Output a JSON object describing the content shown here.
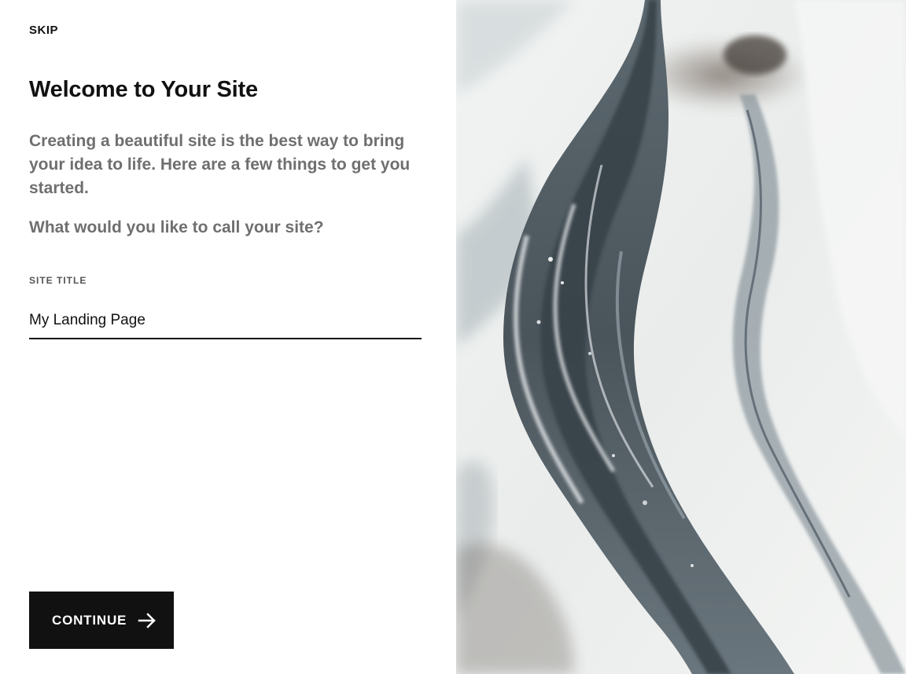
{
  "header": {
    "skip_label": "SKIP"
  },
  "main": {
    "title": "Welcome to Your Site",
    "intro": "Creating a beautiful site is the best way to bring your idea to life. Here are a few things to get you started.",
    "question": "What would you like to call your site?",
    "site_title_field": {
      "label": "SITE TITLE",
      "value": "My Landing Page"
    },
    "continue_label": "CONTINUE"
  },
  "icons": {
    "continue": "arrow-right-icon"
  },
  "colors": {
    "button_bg": "#111111",
    "text_muted": "#6f6f6f",
    "text_primary": "#111111"
  },
  "image": {
    "subject": "abstract-marble-fluid-art"
  }
}
